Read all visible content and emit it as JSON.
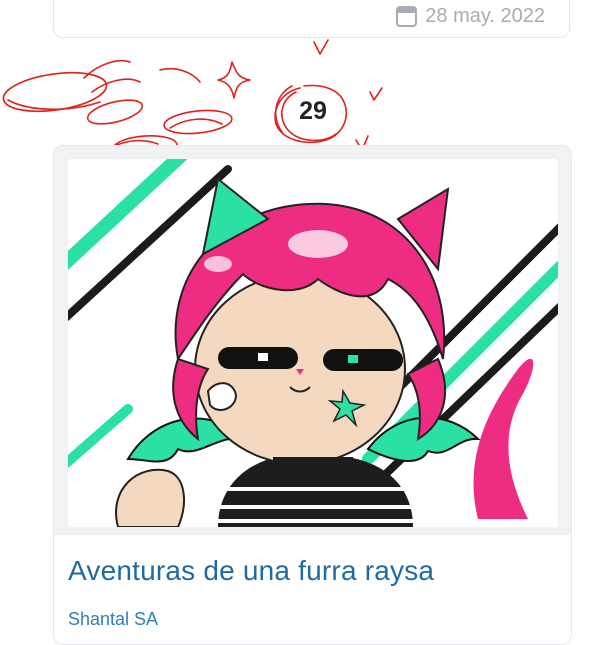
{
  "previous_post": {
    "date": "28 may. 2022",
    "date_icon": "calendar-icon"
  },
  "ranking": {
    "number": "29"
  },
  "post": {
    "title": "Aventuras de una furra raysa",
    "author": "Shantal SA"
  },
  "colors": {
    "title": "#1e6aa1",
    "author": "#2f7fb5",
    "doodle": "#e0211c",
    "card_bg": "#f1f2f4",
    "date_text": "#a7adb5"
  }
}
